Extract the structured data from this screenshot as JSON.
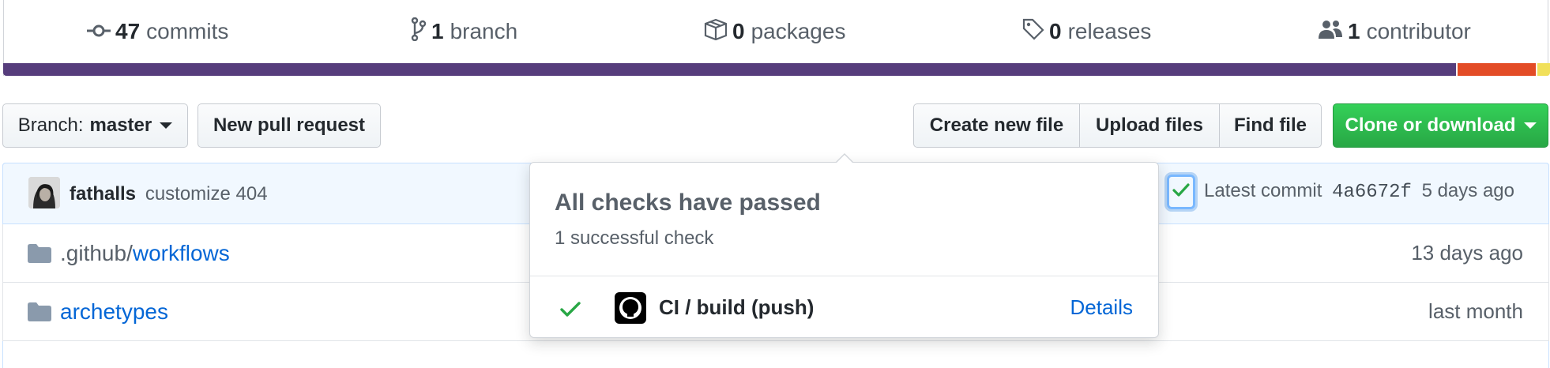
{
  "summary": {
    "commits": {
      "count": "47",
      "label": "commits",
      "icon": "commit-icon"
    },
    "branch": {
      "count": "1",
      "label": "branch",
      "icon": "branch-icon"
    },
    "packages": {
      "count": "0",
      "label": "packages",
      "icon": "package-icon"
    },
    "releases": {
      "count": "0",
      "label": "releases",
      "icon": "tag-icon"
    },
    "contributors": {
      "count": "1",
      "label": "contributor",
      "icon": "people-icon"
    }
  },
  "languages": [
    {
      "color": "#563d7c",
      "share": 0.941
    },
    {
      "color": "#e34c26",
      "share": 0.051
    },
    {
      "color": "#f1e05a",
      "share": 0.008
    }
  ],
  "toolbar": {
    "branch_prefix": "Branch:",
    "branch_name": "master",
    "new_pull_request": "New pull request",
    "create_new_file": "Create new file",
    "upload_files": "Upload files",
    "find_file": "Find file",
    "clone_or_download": "Clone or download"
  },
  "commit": {
    "author": "fathalls",
    "message": "customize 404",
    "latest_label": "Latest commit",
    "sha": "4a6672f",
    "age": "5 days ago"
  },
  "files": [
    {
      "prefix": ".github/",
      "name": "workflows",
      "age": "13 days ago",
      "icon": "folder-icon"
    },
    {
      "prefix": "",
      "name": "archetypes",
      "age": "last month",
      "icon": "folder-icon"
    }
  ],
  "popover": {
    "title": "All checks have passed",
    "subtitle": "1 successful check",
    "check_name": "CI / build (push)",
    "details_label": "Details"
  },
  "colors": {
    "accent": "#0366d6",
    "success": "#28a745",
    "commit_bg": "#f1f8ff"
  }
}
